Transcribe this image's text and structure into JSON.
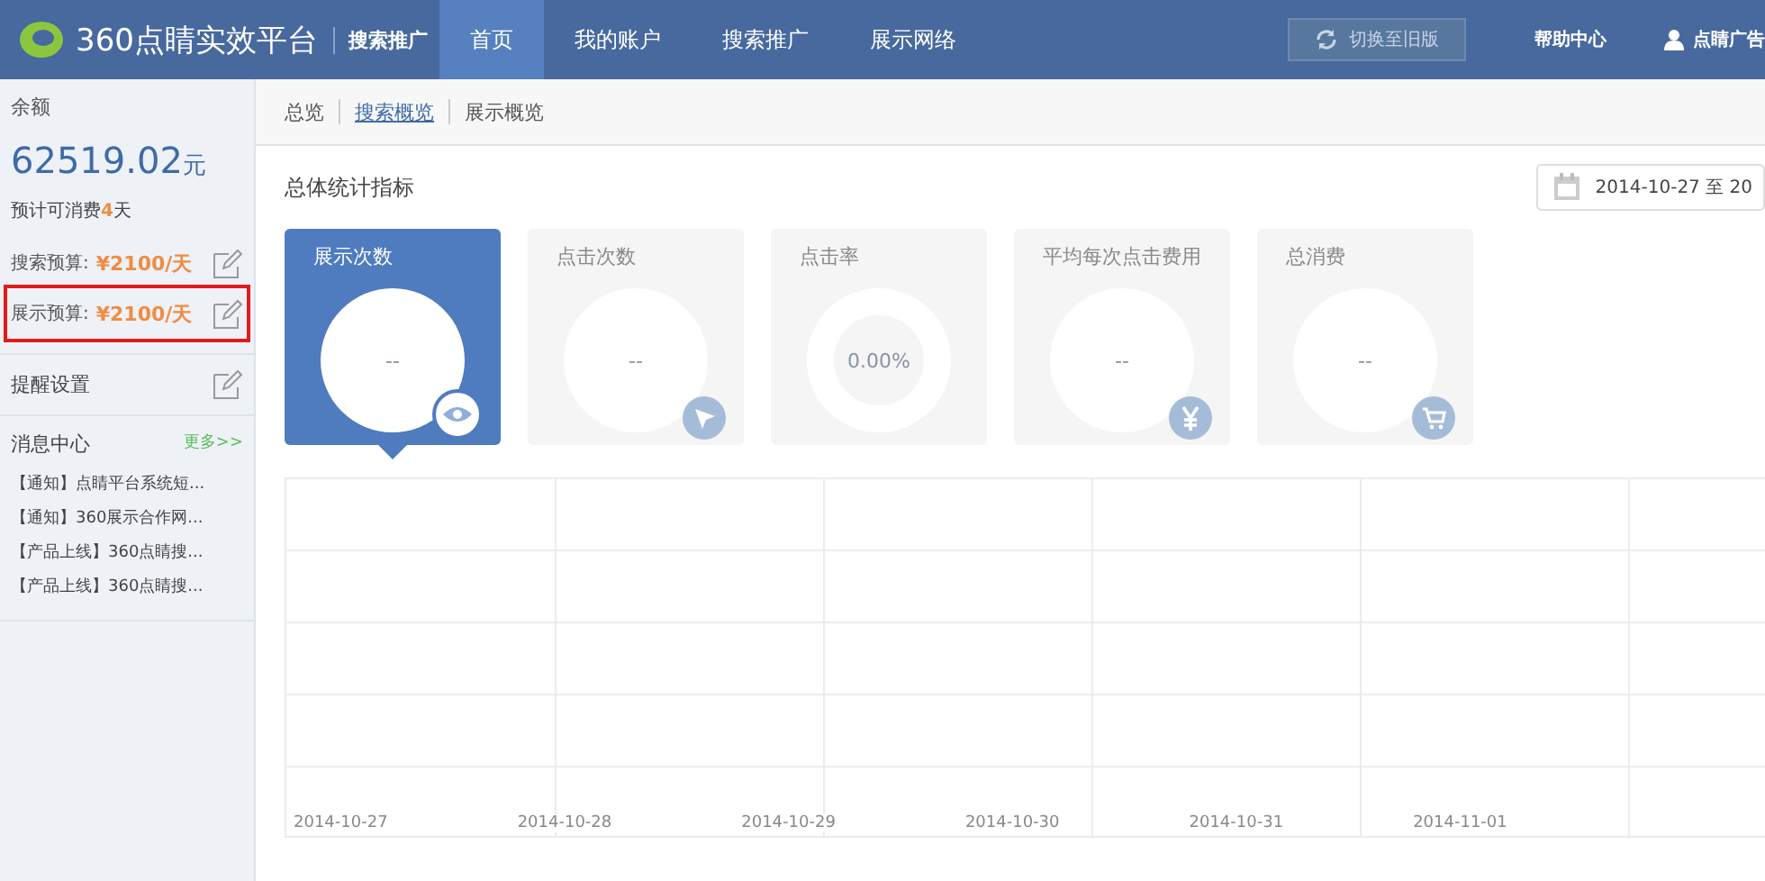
{
  "header": {
    "logo_text": "360点睛实效平台",
    "product": "搜索推广",
    "nav": [
      {
        "label": "首页",
        "selected": true
      },
      {
        "label": "我的账户",
        "selected": false
      },
      {
        "label": "搜索推广",
        "selected": false
      },
      {
        "label": "展示网络",
        "selected": false
      }
    ],
    "switch_button": "切换至旧版",
    "help": "帮助中心",
    "user": "点睛广告"
  },
  "sidebar": {
    "balance_label": "余额",
    "balance": "62519.02",
    "balance_unit": "元",
    "estimate_prefix": "预计可消费",
    "estimate_days": "4",
    "estimate_suffix": "天",
    "budgets": [
      {
        "label": "搜索预算:",
        "value": "¥2100/天",
        "highlighted": false
      },
      {
        "label": "展示预算:",
        "value": "¥2100/天",
        "highlighted": true
      }
    ],
    "reminder": "提醒设置",
    "messages_title": "消息中心",
    "more": "更多>>",
    "messages": [
      "【通知】点睛平台系统短...",
      "【通知】360展示合作网...",
      "【产品上线】360点睛搜...",
      "【产品上线】360点睛搜..."
    ]
  },
  "subtabs": [
    {
      "label": "总览",
      "selected": false
    },
    {
      "label": "搜索概览",
      "selected": true
    },
    {
      "label": "展示概览",
      "selected": false
    }
  ],
  "section_title": "总体统计指标",
  "date_range": "2014-10-27 至 20",
  "metrics": [
    {
      "label": "展示次数",
      "value": "--",
      "kind": "eye",
      "selected": true
    },
    {
      "label": "点击次数",
      "value": "--",
      "kind": "cursor",
      "selected": false
    },
    {
      "label": "点击率",
      "value": "0.00%",
      "kind": "ring",
      "selected": false
    },
    {
      "label": "平均每次点击费用",
      "value": "--",
      "kind": "yen",
      "selected": false
    },
    {
      "label": "总消费",
      "value": "--",
      "kind": "cart",
      "selected": false
    }
  ],
  "chart_x_labels": [
    "2014-10-27",
    "2014-10-28",
    "2014-10-29",
    "2014-10-30",
    "2014-10-31",
    "2014-11-01"
  ]
}
